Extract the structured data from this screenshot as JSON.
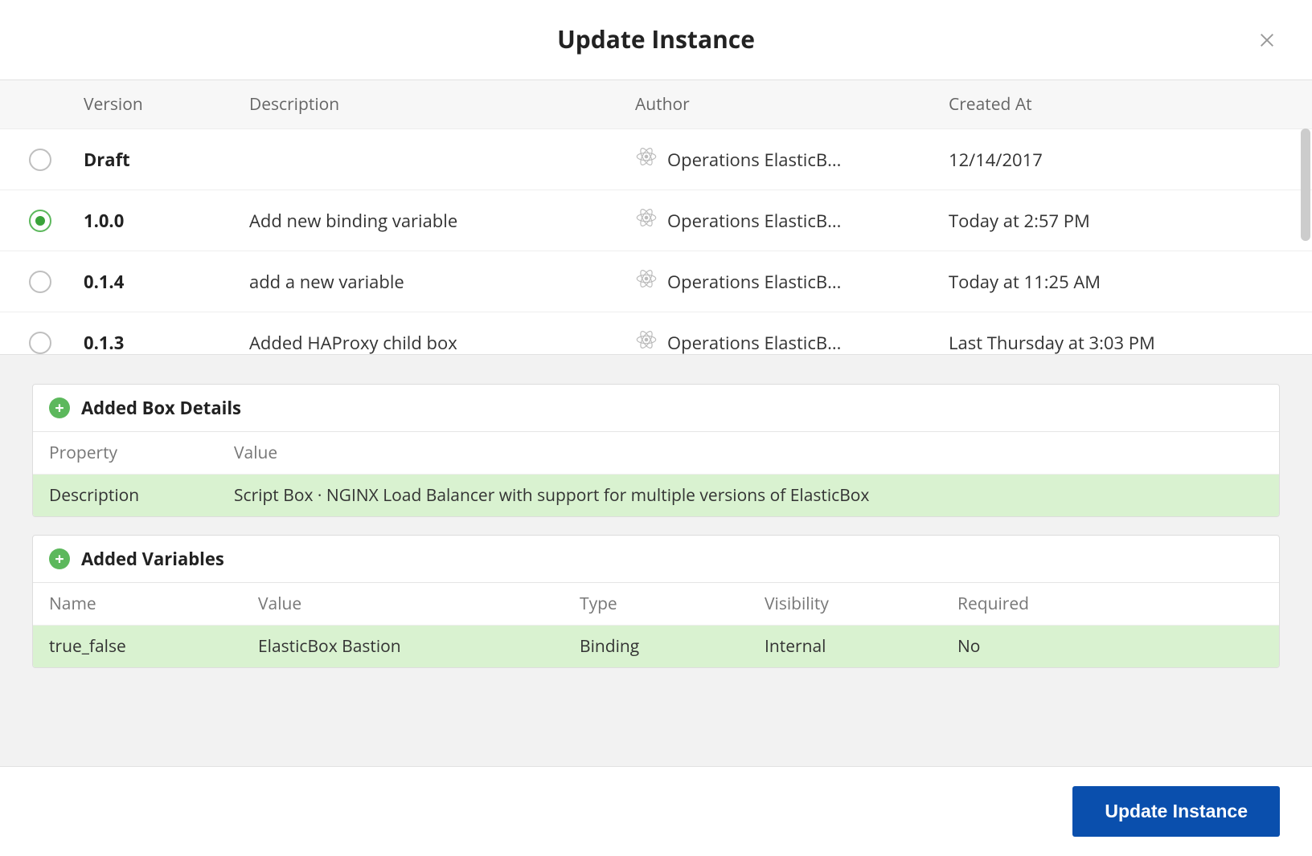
{
  "modal": {
    "title": "Update Instance",
    "close_label": "Close"
  },
  "table": {
    "headers": {
      "version": "Version",
      "description": "Description",
      "author": "Author",
      "created_at": "Created At"
    },
    "rows": [
      {
        "selected": false,
        "version": "Draft",
        "description": "",
        "author": "Operations ElasticB...",
        "created_at": "12/14/2017"
      },
      {
        "selected": true,
        "version": "1.0.0",
        "description": "Add new binding variable",
        "author": "Operations ElasticB...",
        "created_at": "Today at 2:57 PM"
      },
      {
        "selected": false,
        "version": "0.1.4",
        "description": "add a new variable",
        "author": "Operations ElasticB...",
        "created_at": "Today at 11:25 AM"
      },
      {
        "selected": false,
        "version": "0.1.3",
        "description": "Added HAProxy child box",
        "author": "Operations ElasticB...",
        "created_at": "Last Thursday at 3:03 PM"
      }
    ]
  },
  "details": {
    "box_details": {
      "title": "Added Box Details",
      "headers": {
        "property": "Property",
        "value": "Value"
      },
      "row": {
        "property": "Description",
        "value": "Script Box · NGINX Load Balancer with support for multiple versions of ElasticBox"
      }
    },
    "variables": {
      "title": "Added Variables",
      "headers": {
        "name": "Name",
        "value": "Value",
        "type": "Type",
        "visibility": "Visibility",
        "required": "Required"
      },
      "row": {
        "name": "true_false",
        "value": "ElasticBox Bastion",
        "type": "Binding",
        "visibility": "Internal",
        "required": "No"
      }
    }
  },
  "footer": {
    "update_label": "Update Instance"
  }
}
